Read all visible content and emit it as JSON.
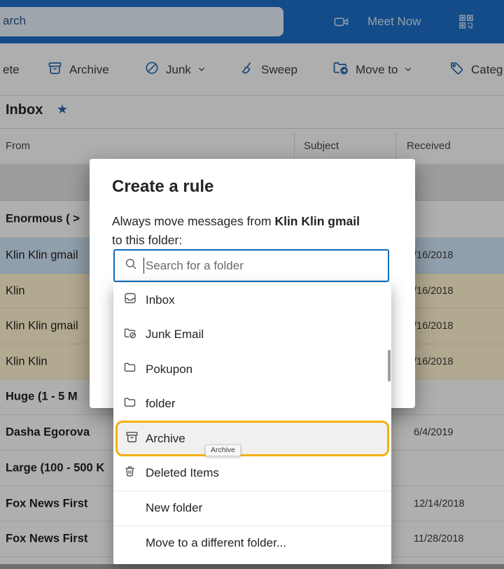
{
  "colors": {
    "accent_blue": "#0f6cbd",
    "topbar_blue": "#1e6ec6",
    "highlight_gold": "#f2b10e",
    "selected_row_blue": "#cfe4f7",
    "flagged_row_yellow": "#fff4ce"
  },
  "topbar": {
    "search_visible_text": "arch",
    "meet_now_label": "Meet Now",
    "icons": {
      "video_camera": "video-camera-icon",
      "qr_code": "qr-code-icon"
    }
  },
  "toolbar": {
    "items": [
      {
        "label": "ete",
        "icon": "none"
      },
      {
        "label": "Archive",
        "icon": "archive-icon"
      },
      {
        "label": "Junk",
        "icon": "block-icon",
        "chevron": true
      },
      {
        "label": "Sweep",
        "icon": "broom-icon"
      },
      {
        "label": "Move to",
        "icon": "move-to-folder-icon",
        "chevron": true
      },
      {
        "label": "Categ",
        "icon": "tag-icon"
      }
    ]
  },
  "mailbox": {
    "title": "Inbox",
    "star_icon": "★",
    "columns": {
      "from": "From",
      "subject": "Subject",
      "received": "Received"
    },
    "rows": [
      {
        "from": "",
        "received": "",
        "kind": "empty-selected"
      },
      {
        "from": "Enormous ( >",
        "received": "",
        "kind": "group-header"
      },
      {
        "from": "Klin Klin gmail",
        "received": "/16/2018",
        "kind": "selected"
      },
      {
        "from": "Klin",
        "received": "/16/2018",
        "kind": "flagged"
      },
      {
        "from": "Klin Klin gmail",
        "received": "/16/2018",
        "kind": "flagged"
      },
      {
        "from": "Klin Klin",
        "received": "/16/2018",
        "kind": "flagged"
      },
      {
        "from": "Huge (1 - 5 M",
        "received": "",
        "kind": "group-header"
      },
      {
        "from": "Dasha Egorova",
        "received": "6/4/2019",
        "kind": "unread"
      },
      {
        "from": "Large (100 - 500 K",
        "received": "",
        "kind": "group-header"
      },
      {
        "from": "Fox News First",
        "received": "12/14/2018",
        "kind": "unread"
      },
      {
        "from": "Fox News First",
        "received": "11/28/2018",
        "kind": "unread"
      }
    ]
  },
  "dialog": {
    "title": "Create a rule",
    "body_prefix": "Always move messages from ",
    "body_sender": "Klin Klin gmail",
    "body_suffix": "to this folder:",
    "search_placeholder": "Search for a folder",
    "folder_list": [
      {
        "label": "Inbox",
        "icon": "inbox-icon"
      },
      {
        "label": "Junk Email",
        "icon": "junk-folder-icon"
      },
      {
        "label": "Pokupon",
        "icon": "folder-icon"
      },
      {
        "label": "folder",
        "icon": "folder-icon"
      },
      {
        "label": "Archive",
        "icon": "archive-icon",
        "highlighted": true,
        "tooltip": "Archive"
      },
      {
        "label": "Deleted Items",
        "icon": "trash-icon"
      },
      {
        "label": "New folder",
        "icon": "none"
      },
      {
        "label": "Move to a different folder...",
        "icon": "none"
      }
    ]
  }
}
